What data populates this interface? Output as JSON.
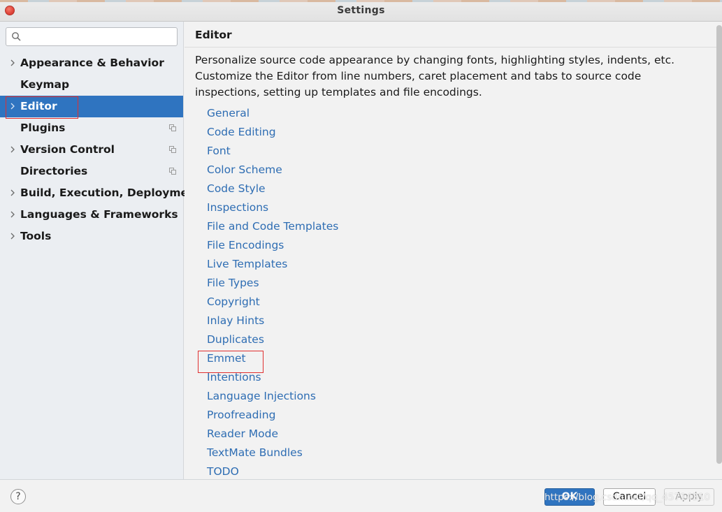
{
  "window": {
    "title": "Settings"
  },
  "search": {
    "value": "",
    "placeholder": ""
  },
  "sidebar": {
    "items": [
      {
        "label": "Appearance & Behavior",
        "expandable": true,
        "selected": false,
        "has_copy_icon": false
      },
      {
        "label": "Keymap",
        "expandable": false,
        "selected": false,
        "has_copy_icon": false
      },
      {
        "label": "Editor",
        "expandable": true,
        "selected": true,
        "has_copy_icon": false
      },
      {
        "label": "Plugins",
        "expandable": false,
        "selected": false,
        "has_copy_icon": true
      },
      {
        "label": "Version Control",
        "expandable": true,
        "selected": false,
        "has_copy_icon": true
      },
      {
        "label": "Directories",
        "expandable": false,
        "selected": false,
        "has_copy_icon": true
      },
      {
        "label": "Build, Execution, Deployment",
        "expandable": true,
        "selected": false,
        "has_copy_icon": false
      },
      {
        "label": "Languages & Frameworks",
        "expandable": true,
        "selected": false,
        "has_copy_icon": false
      },
      {
        "label": "Tools",
        "expandable": true,
        "selected": false,
        "has_copy_icon": false
      }
    ]
  },
  "main": {
    "title": "Editor",
    "description": "Personalize source code appearance by changing fonts, highlighting styles, indents, etc. Customize the Editor from line numbers, caret placement and tabs to source code inspections, setting up templates and file encodings.",
    "links": [
      "General",
      "Code Editing",
      "Font",
      "Color Scheme",
      "Code Style",
      "Inspections",
      "File and Code Templates",
      "File Encodings",
      "Live Templates",
      "File Types",
      "Copyright",
      "Inlay Hints",
      "Duplicates",
      "Emmet",
      "Intentions",
      "Language Injections",
      "Proofreading",
      "Reader Mode",
      "TextMate Bundles",
      "TODO"
    ]
  },
  "footer": {
    "help_label": "?",
    "ok_label": "OK",
    "cancel_label": "Cancel",
    "apply_label": "Apply",
    "watermark": "https://blog.csdn.net/qq_45714310"
  },
  "colors": {
    "accent": "#2f74c0",
    "link": "#2e6db3",
    "highlight_box": "#e03030",
    "sidebar_bg": "#ebeef2"
  },
  "icons": {
    "search": "search-icon",
    "chevron": "chevron-right-icon",
    "copy": "copy-icon",
    "close": "close-icon",
    "help": "help-icon"
  }
}
